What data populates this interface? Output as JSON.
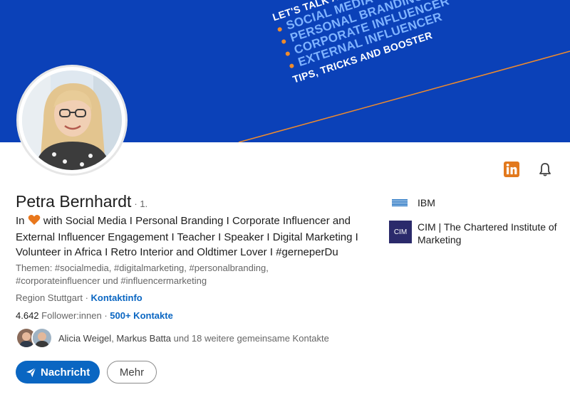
{
  "banner": {
    "headline": "LET'S TALK AND EXCHANGE!",
    "items": [
      "SOCIAL MEDIA",
      "PERSONAL BRANDING",
      "CORPORATE INFLUENCER",
      "EXTERNAL INFLUENCER"
    ],
    "footer": "TIPS, TRICKS AND BOOSTER",
    "colors": {
      "background": "#0b41b8",
      "accent": "#f08b2c",
      "item_text": "#7fb3ff"
    }
  },
  "profile": {
    "name": "Petra Bernhardt",
    "degree": "· 1.",
    "headline_prefix": "In",
    "headline_rest": "with Social Media I Personal Branding I Corporate Influencer and External Influencer Engagement I Teacher I Speaker I Digital Marketing I Volunteer in Africa I Retro Interior and Oldtimer Lover I #gerneperDu",
    "topics": "Themen: #socialmedia, #digitalmarketing, #personalbranding, #corporateinfluencer und #influencermarketing",
    "location": "Region Stuttgart",
    "location_sep": " · ",
    "contact_info": "Kontaktinfo",
    "followers_count": "4.642",
    "followers_label": "Follower:innen",
    "stats_sep": " · ",
    "connections": "500+ Kontakte",
    "mutual": {
      "name1": "Alicia Weigel",
      "sep": ", ",
      "name2": "Markus Batta",
      "rest": " und 18 weitere gemeinsame Kontakte"
    }
  },
  "actions": {
    "message_label": "Nachricht",
    "more_label": "Mehr"
  },
  "companies": [
    {
      "name": "IBM",
      "logo_text": "IBM"
    },
    {
      "name": "CIM | The Chartered Institute of Marketing",
      "logo_text": "CIM"
    }
  ],
  "icons": {
    "linkedin": "linkedin-icon",
    "bell": "bell-icon",
    "send": "send-icon",
    "heart": "heart-icon"
  },
  "colors": {
    "link": "#0a66c2",
    "linkedin_orange": "#e2791d"
  }
}
